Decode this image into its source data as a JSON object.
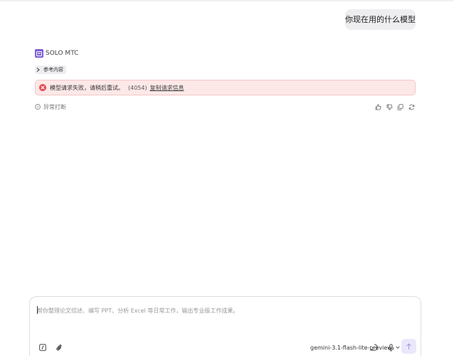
{
  "conversation": {
    "user_message": "你现在用的什么模型",
    "agent": {
      "name": "SOLO MTC",
      "avatar_icon": "agent-square-icon"
    },
    "reference_chip": {
      "label": "参考内容",
      "icon": "chevron-right-icon"
    },
    "error": {
      "message": "模型请求失败，请稍后重试。",
      "code": "(4054)",
      "link": "复制请求信息",
      "icon": "error-circle-icon"
    },
    "abnormal_status": {
      "label": "异常打断",
      "icon": "minus-circle-icon"
    },
    "actions": [
      "thumbs-up-icon",
      "thumbs-down-icon",
      "copy-icon",
      "refresh-icon"
    ]
  },
  "composer": {
    "placeholder": "帮你整理论文综述、编写 PPT、分析 Excel 等日常工作，输出专业级工作成果。",
    "value": "",
    "model": "gemini-3.1-flash-lite-preview"
  },
  "colors": {
    "accent": "#7c5cd6",
    "error_bg": "#fde8e8",
    "error_border": "#f5c6c6",
    "error_icon": "#e5484d",
    "send_bg": "#ebe7fb"
  }
}
